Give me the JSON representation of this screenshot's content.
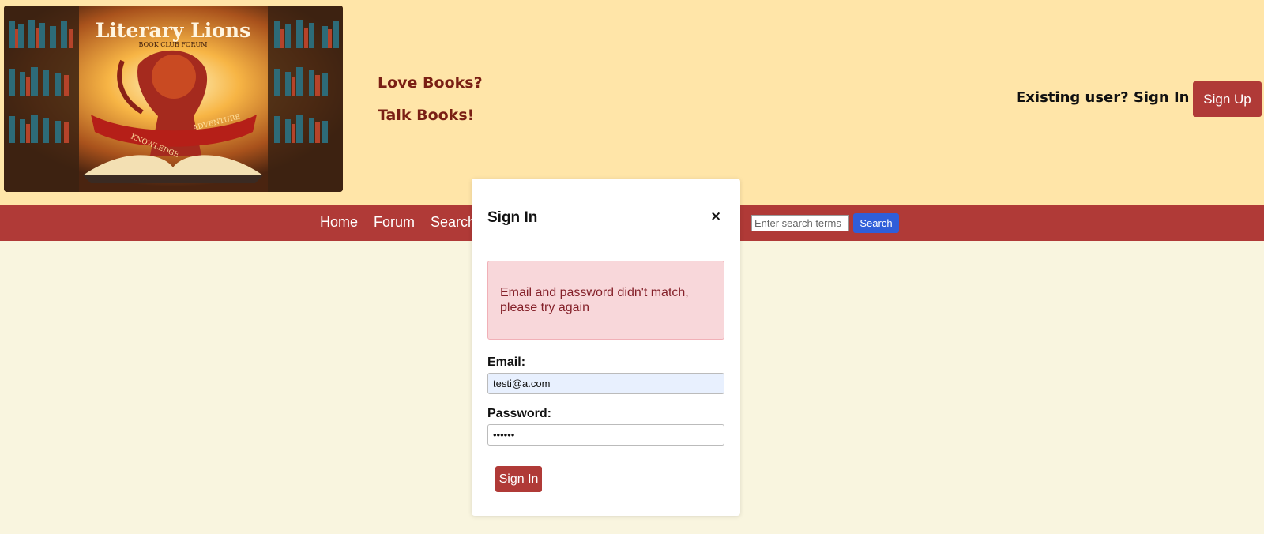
{
  "header": {
    "logo": {
      "title": "Literary Lions",
      "subtitle": "BOOK CLUB FORUM",
      "banner_left": "KNOWLEDGE",
      "banner_right": "ADVENTURE"
    },
    "tagline_1": "Love Books?",
    "tagline_2": "Talk Books!",
    "existing_user_label": "Existing user? Sign In ▼",
    "signup_label": "Sign Up"
  },
  "nav": {
    "items": [
      "Home",
      "Forum",
      "Search"
    ],
    "search_placeholder": "Enter search terms",
    "search_button": "Search"
  },
  "modal": {
    "title": "Sign In",
    "close_label": "×",
    "error_message": "Email and password didn't match, please try again",
    "email_label": "Email:",
    "email_value": "testi@a.com",
    "password_label": "Password:",
    "password_value": "••••••",
    "submit_label": "Sign In"
  },
  "colors": {
    "header_bg": "#ffe5a8",
    "nav_bg": "#b03a37",
    "page_bg": "#f9f5df",
    "search_button": "#2f5ed9",
    "alert_bg": "#f8d7da",
    "alert_text": "#842029"
  }
}
